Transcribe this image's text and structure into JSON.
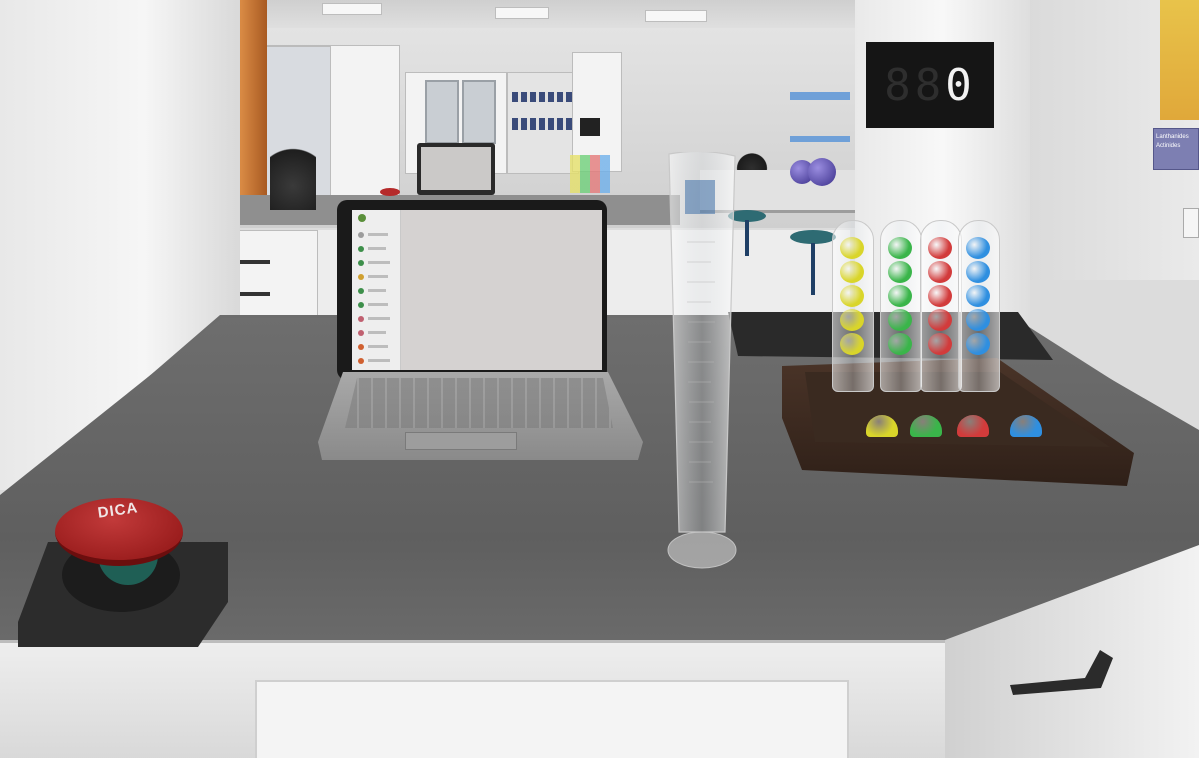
{
  "hud": {
    "counter_dim": "88",
    "counter_lit": "0"
  },
  "hint_button": {
    "label": "DICA"
  },
  "poster": {
    "legend_line_1": "Lanthanides",
    "legend_line_2": "Actinides"
  },
  "colors": {
    "yellow": "#d9d52a",
    "green": "#3ab54a",
    "red": "#d23b3b",
    "blue": "#2f8fe0",
    "counter_text": "#f2f2f2",
    "button_red": "#b52a2a"
  },
  "tube_columns": [
    {
      "color": "yellow",
      "balls": 5
    },
    {
      "color": "green",
      "balls": 5
    },
    {
      "color": "red",
      "balls": 5
    },
    {
      "color": "blue",
      "balls": 5
    }
  ],
  "tray_targets": [
    "yellow",
    "green",
    "red",
    "blue"
  ],
  "icons": {
    "laptop": "laptop-icon",
    "cylinder": "graduated-cylinder-icon",
    "button": "push-button-icon"
  }
}
